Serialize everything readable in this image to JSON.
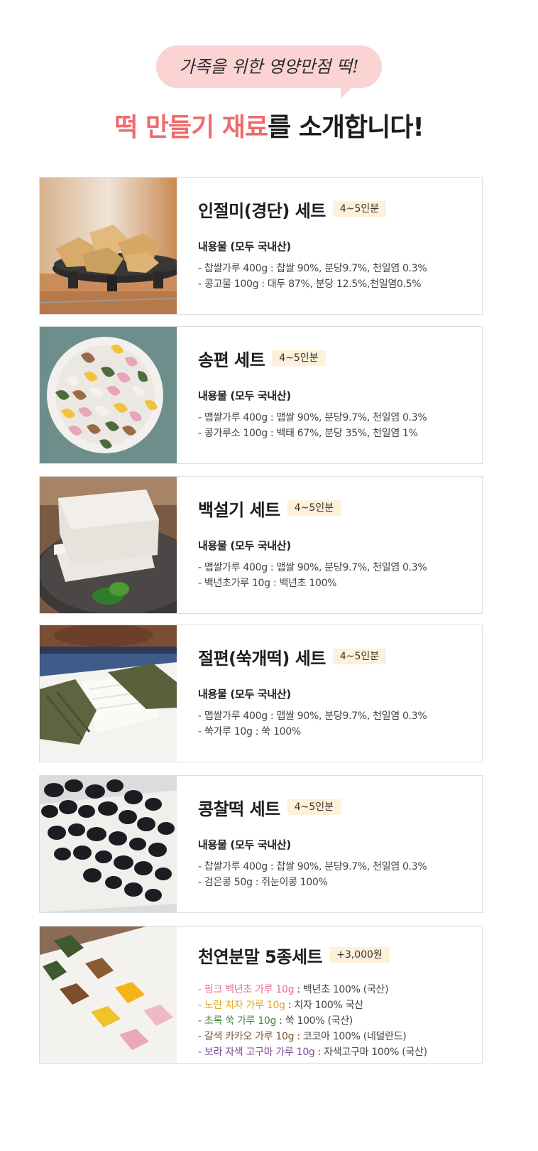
{
  "header": {
    "bubble": "가족을 위한 영양만점 떡!",
    "headline_highlight": "떡 만들기 재료",
    "headline_rest": "를 소개합니다!"
  },
  "colors": {
    "bubble_bg": "#fbd3d3",
    "highlight": "#ef6b6b",
    "badge_bg": "#fff0d9",
    "pink": "#e56f9a",
    "yellow": "#e0a41e",
    "green": "#3f8a3a",
    "brown": "#7a5536",
    "purple": "#7a4d9c"
  },
  "sets": [
    {
      "title": "인절미(경단) 세트",
      "badge": "4~5인분",
      "contents_label": "내용물 (모두 국내산)",
      "lines": [
        "- 찹쌀가루 400g : 찹쌀 90%, 분당9.7%, 천일염 0.3%",
        "- 콩고물 100g : 대두 87%, 분당 12.5%,천일염0.5%"
      ]
    },
    {
      "title": "송편 세트",
      "badge": "4~5인분",
      "contents_label": "내용물 (모두 국내산)",
      "lines": [
        "- 맵쌀가루 400g : 맵쌀 90%, 분당9.7%, 천일염 0.3%",
        "- 콩가루소 100g : 백태 67%, 분당 35%, 천일염 1%"
      ]
    },
    {
      "title": "백설기 세트",
      "badge": "4~5인분",
      "contents_label": "내용물 (모두 국내산)",
      "lines": [
        "- 맵쌀가루 400g : 맵쌀 90%, 분당9.7%, 천일염 0.3%",
        "- 백년초가루 10g : 백년초 100%"
      ]
    },
    {
      "title": "절편(쑥개떡) 세트",
      "badge": "4~5인분",
      "contents_label": "내용물 (모두 국내산)",
      "lines": [
        "- 맵쌀가루 400g : 맵쌀 90%, 분당9.7%, 천일염 0.3%",
        "- 쑥가루 10g : 쑥 100%"
      ]
    },
    {
      "title": "콩찰떡 세트",
      "badge": "4~5인분",
      "contents_label": "내용물 (모두 국내산)",
      "lines": [
        "- 찹쌀가루 400g : 찹쌀 90%, 분당9.7%, 천일염 0.3%",
        "- 검은콩 50g : 쥐눈이콩 100%"
      ]
    }
  ],
  "powder_set": {
    "title": "천연분말 5종세트",
    "badge": "+3,000원",
    "items": [
      {
        "name": "- 핑크 백년초 가루 10g",
        "detail": " : 백년초 100% (국산)",
        "color": "#e56f9a"
      },
      {
        "name": "- 노란 치자 가루 10g",
        "detail": " : 치자 100% 국산",
        "color": "#e0a41e"
      },
      {
        "name": "- 초록 쑥 가루 10g",
        "detail": " : 쑥 100% (국산)",
        "color": "#3f8a3a"
      },
      {
        "name": "- 갈색 카카오 가루 10g",
        "detail": " : 코코아 100% (네덜란드)",
        "color": "#7a5536"
      },
      {
        "name": "- 보라 자색 고구마 가루 10g",
        "detail": " : 자색고구마 100% (국산)",
        "color": "#7a4d9c"
      }
    ]
  }
}
